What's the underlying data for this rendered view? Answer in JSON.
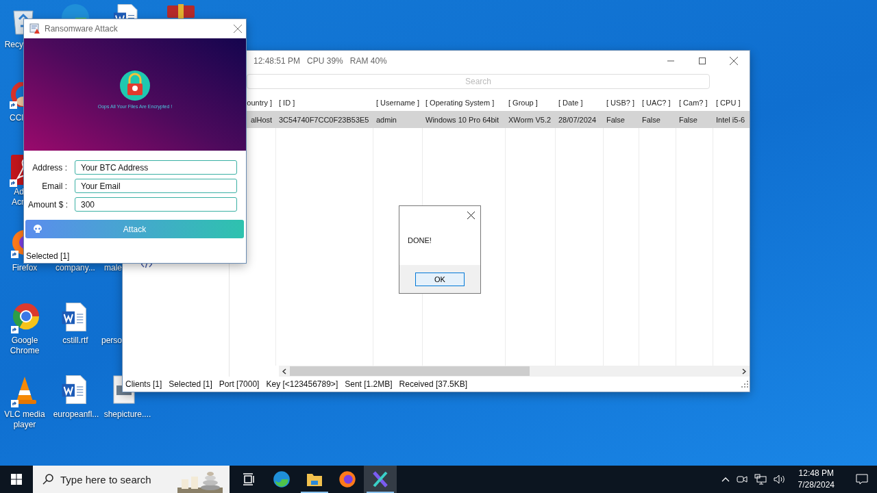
{
  "desktop_icons": [
    {
      "kind": "recycle-bin",
      "label": "Recy",
      "shortcut": false
    },
    {
      "kind": "edge",
      "shortcut": false
    },
    {
      "kind": "document",
      "shortcut": false
    },
    {
      "kind": "archive",
      "shortcut": false
    },
    {
      "kind": "ccleaner",
      "label": "CCl",
      "shortcut": true
    },
    {
      "kind": "pdf",
      "label": "Ad Acr",
      "shortcut": true
    },
    {
      "kind": "firefox",
      "label": "Firefox",
      "shortcut": true
    },
    {
      "label": "company..."
    },
    {
      "label": "male"
    },
    {
      "kind": "chrome",
      "label": "Google Chrome",
      "shortcut": true
    },
    {
      "kind": "document",
      "label": "cstill.rtf",
      "shortcut": false
    },
    {
      "label": "perso"
    },
    {
      "kind": "vlc",
      "label": "VLC media player",
      "shortcut": true
    },
    {
      "kind": "document",
      "label": "europeanfl...",
      "shortcut": false
    },
    {
      "kind": "image",
      "label": "shepicture....",
      "shortcut": false
    }
  ],
  "main_window": {
    "header": [
      "12:48:51 PM",
      "CPU 39%",
      "RAM 40%"
    ],
    "search": {
      "placeholder": "Search"
    },
    "table": {
      "columns": [
        "ountry ]",
        "[ ID ]",
        "[ Username ]",
        "[ Operating System ]",
        "[ Group ]",
        "[ Date ]",
        "[ USB? ]",
        "[ UAC? ]",
        "[ Cam? ]",
        "[ CPU ]"
      ],
      "rows": [
        {
          "selected": true,
          "cells": [
            "alHost",
            "3C54740F7CC0F23B53E5",
            "admin",
            "Windows 10 Pro 64bit",
            "XWorm V5.2",
            "28/07/2024",
            "False",
            "False",
            "False",
            "Intel  i5-6"
          ]
        }
      ]
    },
    "status_bar": [
      "Clients [1]",
      "Selected [1]",
      "Port [7000]",
      "Key [<123456789>]",
      "Sent [1.2MB]",
      "Received [37.5KB]"
    ]
  },
  "ransomware_window": {
    "title": "Ransomware Attack",
    "banner_text": "Oops All Your Files Are Encrypted !",
    "fields": [
      {
        "label": "Address :",
        "value": "Your BTC Address"
      },
      {
        "label": "Email :",
        "value": "Your Email"
      },
      {
        "label": "Amount $ :",
        "value": "300"
      }
    ],
    "button": "Attack",
    "status": "Selected [1]"
  },
  "dialog": {
    "message": "DONE!",
    "button": "OK"
  },
  "taskbar": {
    "search": {
      "placeholder": "Type here to search"
    },
    "apps": [
      {
        "kind": "task-view",
        "running": false,
        "active": false
      },
      {
        "kind": "edge",
        "running": false,
        "active": false
      },
      {
        "kind": "explorer",
        "running": true,
        "active": false
      },
      {
        "kind": "firefox",
        "running": false,
        "active": false
      },
      {
        "kind": "xworm",
        "running": true,
        "active": true
      }
    ],
    "time": "12:48 PM",
    "date": "7/28/2024"
  }
}
